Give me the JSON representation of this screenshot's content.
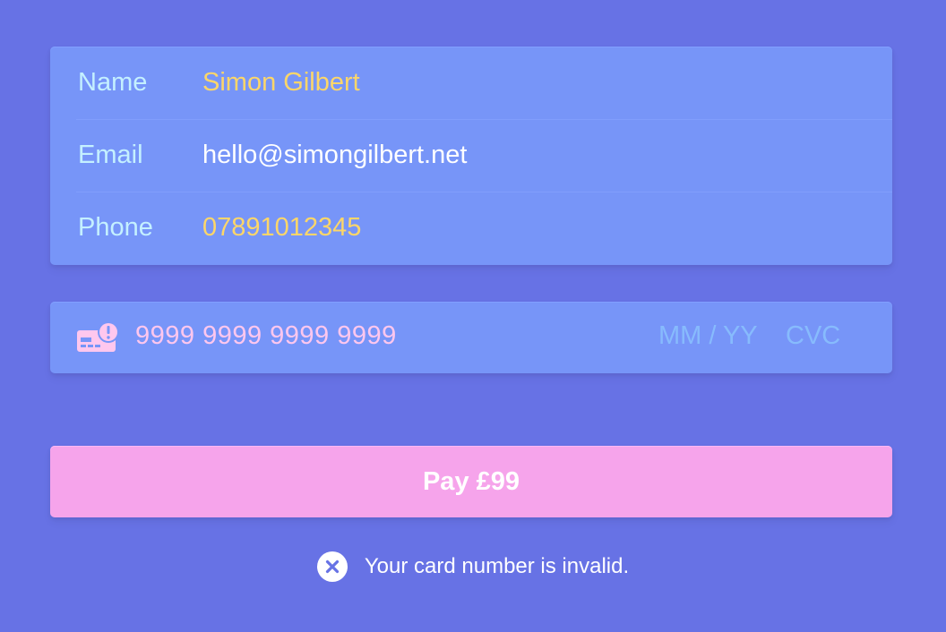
{
  "contact": {
    "rows": [
      {
        "label": "Name",
        "value": "Simon Gilbert"
      },
      {
        "label": "Email",
        "value": "hello@simongilbert.net"
      },
      {
        "label": "Phone",
        "value": "07891012345"
      }
    ]
  },
  "card": {
    "icon": "card-error-icon",
    "number_placeholder": "9999 9999 9999 9999",
    "expiry_placeholder": "MM / YY",
    "cvc_placeholder": "CVC"
  },
  "pay_button": {
    "label": "Pay £99"
  },
  "error": {
    "icon": "close-circle-icon",
    "message": "Your card number is invalid."
  },
  "colors": {
    "background": "#6772e5",
    "field_background": "#7795f8",
    "label": "#c4f0ff",
    "highlight_value": "#fcd669",
    "card_error": "#ffc7ee",
    "placeholder": "#87bbfd",
    "button": "#f6a4eb"
  }
}
